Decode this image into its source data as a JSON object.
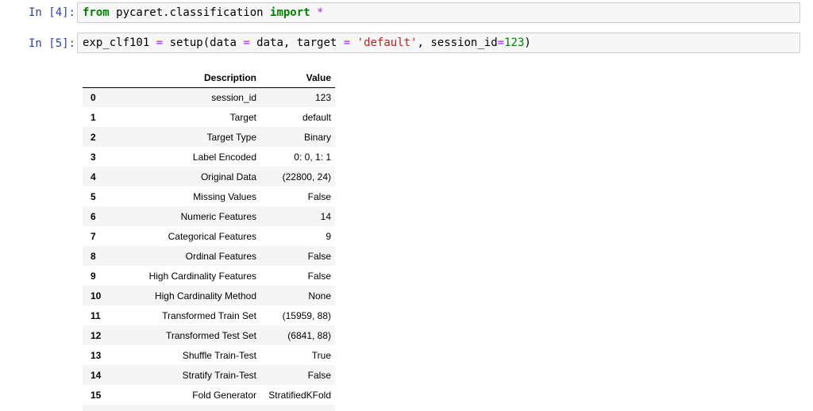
{
  "cells": [
    {
      "prompt": "In [4]:",
      "code_tokens": {
        "t1": "from",
        "t2": " pycaret.classification ",
        "t3": "import",
        "t4": " ",
        "t5": "*"
      }
    },
    {
      "prompt": "In [5]:",
      "code_tokens": {
        "t1": "exp_clf101 ",
        "t2": "=",
        "t3": " setup(data ",
        "t4": "=",
        "t5": " data, target ",
        "t6": "=",
        "t7": " ",
        "t8": "'default'",
        "t9": ", session_id",
        "t10": "=",
        "t11": "123",
        "t12": ")"
      }
    }
  ],
  "output_table": {
    "headers": {
      "index": "",
      "description": "Description",
      "value": "Value"
    },
    "rows": [
      {
        "index": "0",
        "description": "session_id",
        "value": "123"
      },
      {
        "index": "1",
        "description": "Target",
        "value": "default"
      },
      {
        "index": "2",
        "description": "Target Type",
        "value": "Binary"
      },
      {
        "index": "3",
        "description": "Label Encoded",
        "value": "0: 0, 1: 1"
      },
      {
        "index": "4",
        "description": "Original Data",
        "value": "(22800, 24)"
      },
      {
        "index": "5",
        "description": "Missing Values",
        "value": "False"
      },
      {
        "index": "6",
        "description": "Numeric Features",
        "value": "14"
      },
      {
        "index": "7",
        "description": "Categorical Features",
        "value": "9"
      },
      {
        "index": "8",
        "description": "Ordinal Features",
        "value": "False"
      },
      {
        "index": "9",
        "description": "High Cardinality Features",
        "value": "False"
      },
      {
        "index": "10",
        "description": "High Cardinality Method",
        "value": "None"
      },
      {
        "index": "11",
        "description": "Transformed Train Set",
        "value": "(15959, 88)"
      },
      {
        "index": "12",
        "description": "Transformed Test Set",
        "value": "(6841, 88)"
      },
      {
        "index": "13",
        "description": "Shuffle Train-Test",
        "value": "True"
      },
      {
        "index": "14",
        "description": "Stratify Train-Test",
        "value": "False"
      },
      {
        "index": "15",
        "description": "Fold Generator",
        "value": "StratifiedKFold"
      },
      {
        "index": "",
        "description": "",
        "value": ""
      }
    ]
  }
}
